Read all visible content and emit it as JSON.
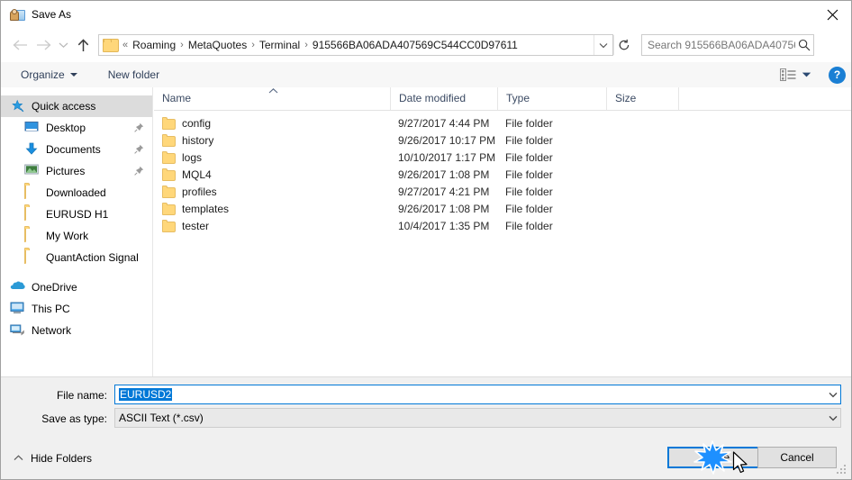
{
  "window": {
    "title": "Save As",
    "title_icon": "save-as-icon",
    "close_icon": "close-icon"
  },
  "nav": {
    "back_icon": "back-arrow-icon",
    "forward_icon": "forward-arrow-icon",
    "recent_icon": "chevron-down-icon",
    "up_icon": "up-arrow-icon",
    "refresh_icon": "refresh-icon",
    "breadcrumb_overflow": "«",
    "breadcrumb": [
      "Roaming",
      "MetaQuotes",
      "Terminal",
      "915566BA06ADA407569C544CC0D97611"
    ],
    "breadcrumb_separator": "›",
    "address_dropdown_icon": "chevron-down-icon"
  },
  "search": {
    "placeholder": "Search 915566BA06ADA40756...",
    "value": "",
    "icon": "search-icon"
  },
  "commandbar": {
    "organize_label": "Organize",
    "new_folder_label": "New folder",
    "view_icon": "list-view-icon",
    "view_dropdown_icon": "chevron-down-icon",
    "help_label": "?",
    "help_icon": "help-icon"
  },
  "sidebar": {
    "items": [
      {
        "label": "Quick access",
        "icon": "star-pin-icon",
        "selected": true,
        "indent": false,
        "pinned": false
      },
      {
        "label": "Desktop",
        "icon": "desktop-icon",
        "selected": false,
        "indent": true,
        "pinned": true
      },
      {
        "label": "Documents",
        "icon": "documents-download-icon",
        "selected": false,
        "indent": true,
        "pinned": true
      },
      {
        "label": "Pictures",
        "icon": "pictures-icon",
        "selected": false,
        "indent": true,
        "pinned": true
      },
      {
        "label": "Downloaded",
        "icon": "folder-icon",
        "selected": false,
        "indent": true,
        "pinned": false
      },
      {
        "label": "EURUSD H1",
        "icon": "folder-icon",
        "selected": false,
        "indent": true,
        "pinned": false
      },
      {
        "label": "My Work",
        "icon": "folder-icon",
        "selected": false,
        "indent": true,
        "pinned": false
      },
      {
        "label": "QuantAction Signal",
        "icon": "folder-icon",
        "selected": false,
        "indent": true,
        "pinned": false
      },
      {
        "label": "OneDrive",
        "icon": "onedrive-cloud-icon",
        "selected": false,
        "indent": false,
        "pinned": false
      },
      {
        "label": "This PC",
        "icon": "this-pc-icon",
        "selected": false,
        "indent": false,
        "pinned": false
      },
      {
        "label": "Network",
        "icon": "network-icon",
        "selected": false,
        "indent": false,
        "pinned": false
      }
    ]
  },
  "filelist": {
    "columns": [
      "Name",
      "Date modified",
      "Type",
      "Size"
    ],
    "sort_indicator": "^",
    "rows": [
      {
        "name": "config",
        "date": "9/27/2017 4:44 PM",
        "type": "File folder",
        "size": ""
      },
      {
        "name": "history",
        "date": "9/26/2017 10:17 PM",
        "type": "File folder",
        "size": ""
      },
      {
        "name": "logs",
        "date": "10/10/2017 1:17 PM",
        "type": "File folder",
        "size": ""
      },
      {
        "name": "MQL4",
        "date": "9/26/2017 1:08 PM",
        "type": "File folder",
        "size": ""
      },
      {
        "name": "profiles",
        "date": "9/27/2017 4:21 PM",
        "type": "File folder",
        "size": ""
      },
      {
        "name": "templates",
        "date": "9/26/2017 1:08 PM",
        "type": "File folder",
        "size": ""
      },
      {
        "name": "tester",
        "date": "10/4/2017 1:35 PM",
        "type": "File folder",
        "size": ""
      }
    ]
  },
  "form": {
    "filename_label": "File name:",
    "filename_value": "EURUSD2",
    "filename_selected": true,
    "filetype_label": "Save as type:",
    "filetype_value": "ASCII Text (*.csv)",
    "dropdown_icon": "chevron-down-icon"
  },
  "footer": {
    "hide_folders_label": "Hide Folders",
    "hide_folders_icon": "chevron-up-icon",
    "save_label": "Save",
    "cancel_label": "Cancel",
    "resize_grip_icon": "resize-grip-icon"
  },
  "interaction": {
    "click_burst_icon": "click-burst-icon",
    "cursor_icon": "mouse-pointer-icon"
  },
  "colors": {
    "accent": "#0078d7",
    "selection": "#0078d7",
    "help_blue": "#1a7fd4",
    "folder_yellow": "#ffd77a",
    "window_bg": "#f0f0f0"
  }
}
